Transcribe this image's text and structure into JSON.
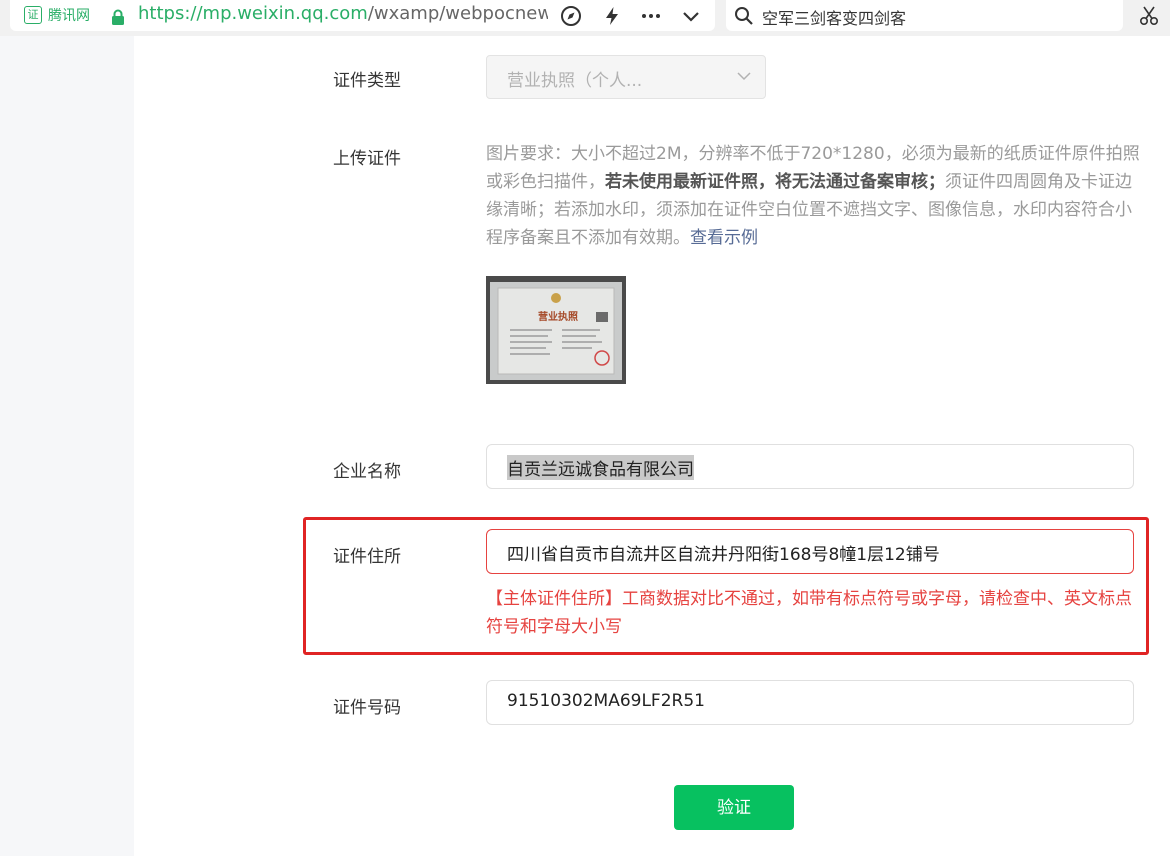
{
  "browser": {
    "cert_badge": "证",
    "cert_org": "腾讯网",
    "url_proto": "https://",
    "url_host": "mp.weixin.qq.com",
    "url_path": "/wxamp/webpocnew/v",
    "search_text": "空军三剑客变四剑客",
    "icons": [
      "compass-icon",
      "lightning-icon",
      "more-icon",
      "chevron-down-icon",
      "search-icon",
      "scissors-icon"
    ]
  },
  "form": {
    "cert_type": {
      "label": "证件类型",
      "value": "营业执照（个人..."
    },
    "upload": {
      "label": "上传证件",
      "desc_part1": "图片要求：大小不超过2M，分辨率不低于720*1280，必须为最新的纸质证件原件拍照或彩色扫描件，",
      "desc_bold": "若未使用最新证件照，将无法通过备案审核；",
      "desc_part2": "须证件四周圆角及卡证边缘清晰；若添加水印，须添加在证件空白位置不遮挡文字、图像信息，水印内容符合小程序备案且不添加有效期。",
      "desc_link": "查看示例",
      "thumb_title": "营业执照"
    },
    "company_name": {
      "label": "企业名称",
      "value": "自贡兰远诚食品有限公司"
    },
    "cert_address": {
      "label": "证件住所",
      "value": "四川省自贡市自流井区自流井丹阳街168号8幢1层12铺号",
      "error": "【主体证件住所】工商数据对比不通过，如带有标点符号或字母，请检查中、英文标点符号和字母大小写"
    },
    "cert_number": {
      "label": "证件号码",
      "value": "91510302MA69LF2R51"
    },
    "verify_button": "验证"
  },
  "colors": {
    "accent_green": "#07c160",
    "error_red": "#e64340",
    "highlight_border": "#e02424",
    "link_blue": "#576b95"
  }
}
